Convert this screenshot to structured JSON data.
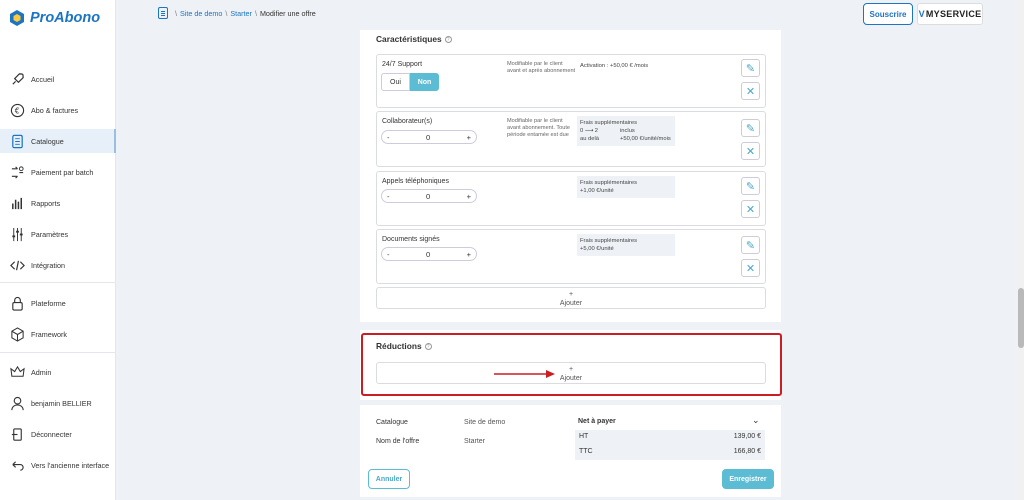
{
  "app": {
    "name": "ProAbono"
  },
  "sidebar": {
    "items": [
      {
        "label": "Accueil",
        "icon": "rocket-icon"
      },
      {
        "label": "Abo & factures",
        "icon": "euro-icon"
      },
      {
        "label": "Catalogue",
        "icon": "catalog-icon"
      },
      {
        "label": "Paiement par batch",
        "icon": "batch-icon"
      },
      {
        "label": "Rapports",
        "icon": "chart-icon"
      },
      {
        "label": "Paramètres",
        "icon": "sliders-icon"
      },
      {
        "label": "Intégration",
        "icon": "code-icon"
      },
      {
        "label": "Plateforme",
        "icon": "lock-icon"
      },
      {
        "label": "Framework",
        "icon": "cube-icon"
      },
      {
        "label": "Admin",
        "icon": "crown-icon"
      },
      {
        "label": "benjamin BELLIER",
        "icon": "user-icon"
      },
      {
        "label": "Déconnecter",
        "icon": "logout-icon"
      },
      {
        "label": "Vers l'ancienne interface",
        "icon": "back-icon"
      }
    ]
  },
  "breadcrumb": {
    "site": "Site de demo",
    "offer": "Starter",
    "current": "Modifier une offre",
    "sep": "\\"
  },
  "header": {
    "subscribe": "Souscrire",
    "brand": "MYSERVICE",
    "brand_letter": "V"
  },
  "features": {
    "title": "Caractéristiques",
    "items": [
      {
        "name": "24/7 Support",
        "desc": "Modifiable par le client avant et après abonnement",
        "price_line1": "Activation : +50,00 € /mois",
        "toggle_off": "Oui",
        "toggle_on": "Non"
      },
      {
        "name": "Collaborateur(s)",
        "desc": "Modifiable par le client avant abonnement. Toute période entamée est due",
        "price_title": "Frais supplémentaires",
        "price_rows": [
          {
            "k": "0 ⟶ 2",
            "v": "inclus"
          },
          {
            "k": "au delà",
            "v": "+50,00 €/unité/mois"
          }
        ],
        "value": "0"
      },
      {
        "name": "Appels téléphoniques",
        "price_title": "Frais supplémentaires",
        "price_line": "+1,00 €/unité",
        "value": "0"
      },
      {
        "name": "Documents signés",
        "price_title": "Frais supplémentaires",
        "price_line": "+5,00 €/unité",
        "value": "0"
      }
    ],
    "add_plus": "+",
    "add_label": "Ajouter",
    "stepper_minus": "-",
    "stepper_plus": "+"
  },
  "reductions": {
    "title": "Réductions",
    "add_plus": "+",
    "add_label": "Ajouter"
  },
  "summary": {
    "catalog_label": "Catalogue",
    "catalog_value": "Site de demo",
    "offer_label": "Nom de l'offre",
    "offer_value": "Starter",
    "net_label": "Net à payer",
    "ht_label": "HT",
    "ht_value": "139,00 €",
    "ttc_label": "TTC",
    "ttc_value": "166,80 €"
  },
  "actions": {
    "cancel": "Annuler",
    "save": "Enregistrer"
  },
  "colors": {
    "primary": "#1c74c2",
    "accent": "#5bbcd4",
    "highlight": "#c81e24"
  }
}
